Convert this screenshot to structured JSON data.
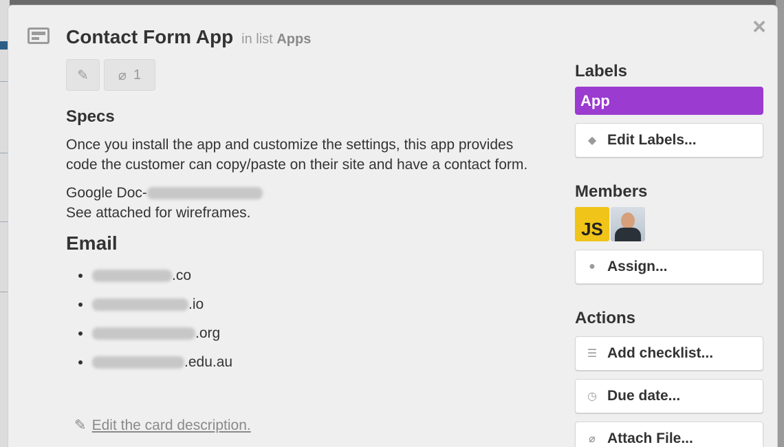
{
  "card": {
    "title": "Contact Form App",
    "in_list_prefix": "in list",
    "list_name": "Apps",
    "attachment_count": "1"
  },
  "description": {
    "specs_heading": "Specs",
    "specs_text": "Once you install the app and customize the settings, this app provides code the customer can copy/paste on their site and have a contact form.",
    "google_doc_prefix": "Google Doc-",
    "wireframes_line": "See attached for wireframes.",
    "email_heading": "Email",
    "emails": [
      {
        "suffix": ".co"
      },
      {
        "suffix": ".io"
      },
      {
        "suffix": ".org"
      },
      {
        "suffix": ".edu.au"
      }
    ],
    "edit_link": "Edit the card description."
  },
  "sidebar": {
    "labels_heading": "Labels",
    "label_app": "App",
    "label_color": "#9b3bd0",
    "edit_labels": "Edit Labels...",
    "members_heading": "Members",
    "member_initials": "JS",
    "assign": "Assign...",
    "actions_heading": "Actions",
    "add_checklist": "Add checklist...",
    "due_date": "Due date...",
    "attach_file": "Attach File..."
  },
  "icons": {
    "close": "×",
    "pencil": "✎",
    "paperclip": "⌀",
    "tag": "◆",
    "person": "●",
    "list": "☰",
    "clock": "◷"
  }
}
